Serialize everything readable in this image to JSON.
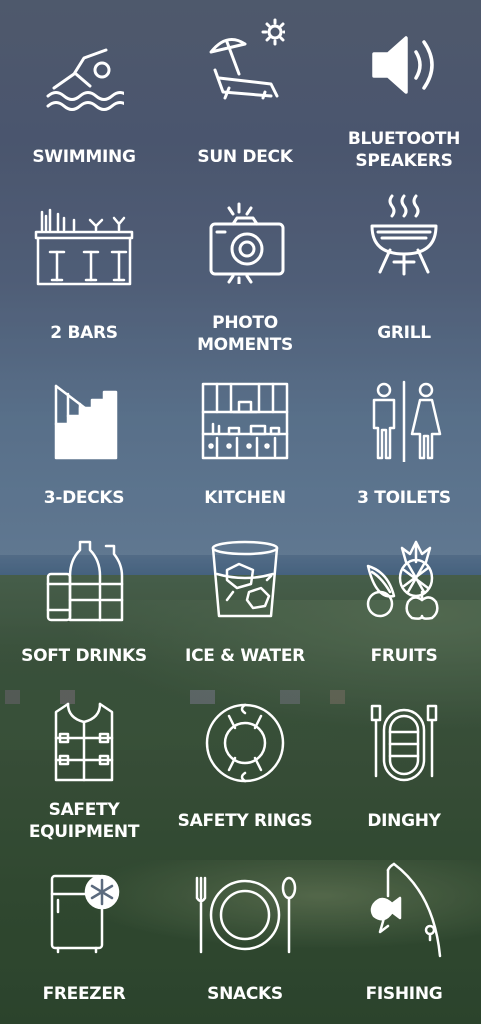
{
  "amenities": [
    {
      "label": "SWIMMING",
      "icon": "swimmer-icon"
    },
    {
      "label": "SUN DECK",
      "icon": "sun-lounger-icon"
    },
    {
      "label": "BLUETOOTH\nSPEAKERS",
      "icon": "speaker-icon"
    },
    {
      "label": "2 BARS",
      "icon": "bar-counter-icon"
    },
    {
      "label": "PHOTO\nMOMENTS",
      "icon": "camera-icon"
    },
    {
      "label": "GRILL",
      "icon": "grill-icon"
    },
    {
      "label": "3-DECKS",
      "icon": "stairs-icon"
    },
    {
      "label": "KITCHEN",
      "icon": "kitchen-icon"
    },
    {
      "label": "3 TOILETS",
      "icon": "toilet-icon"
    },
    {
      "label": "SOFT DRINKS",
      "icon": "soft-drinks-icon"
    },
    {
      "label": "ICE & WATER",
      "icon": "ice-glass-icon"
    },
    {
      "label": "FRUITS",
      "icon": "fruits-icon"
    },
    {
      "label": "SAFETY\nEQUIPMENT",
      "icon": "life-vest-icon"
    },
    {
      "label": "SAFETY RINGS",
      "icon": "life-ring-icon"
    },
    {
      "label": "DINGHY",
      "icon": "dinghy-icon"
    },
    {
      "label": "FREEZER",
      "icon": "freezer-icon"
    },
    {
      "label": "SNACKS",
      "icon": "plate-cutlery-icon"
    },
    {
      "label": "FISHING",
      "icon": "fishing-rod-icon"
    }
  ],
  "colors": {
    "icon_stroke": "#ffffff",
    "text": "#ffffff"
  }
}
